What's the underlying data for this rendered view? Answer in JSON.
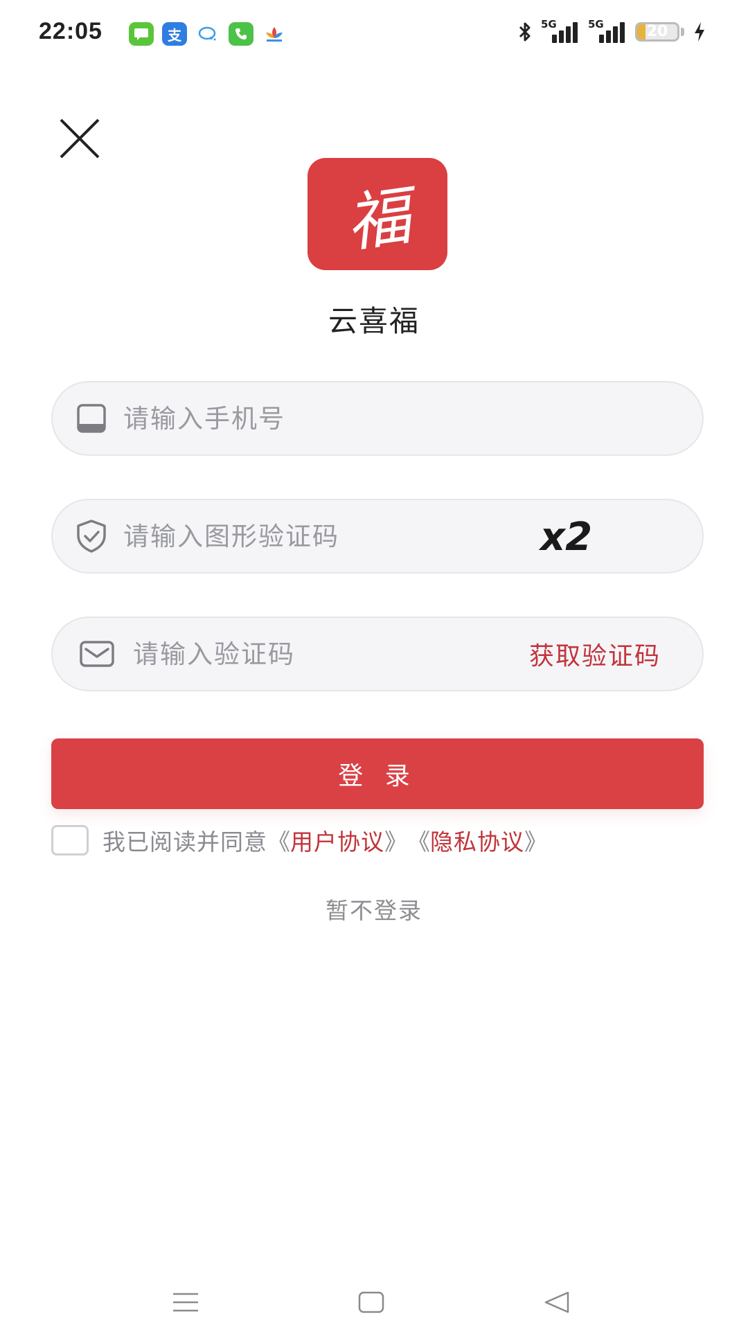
{
  "status_bar": {
    "time": "22:05",
    "notification_icons": [
      {
        "icon": "message-icon",
        "color": "#5ac53a",
        "glyph": "▬"
      },
      {
        "icon": "alipay-icon",
        "color": "#2f7de1",
        "glyph": "支"
      },
      {
        "icon": "bubble-icon",
        "color": "#ffffff",
        "glyph": "◌"
      },
      {
        "icon": "phone-icon",
        "color": "#4cc248",
        "glyph": "✆"
      },
      {
        "icon": "lotus-icon",
        "color": "#ffffff",
        "glyph": "✿"
      }
    ],
    "network_1": "5G",
    "network_2": "5G",
    "battery_level": "20",
    "battery_fraction": 0.2
  },
  "app": {
    "logo_glyph": "福",
    "name": "云喜福",
    "brand_color": "#da3f42"
  },
  "form": {
    "phone_placeholder": "请输入手机号",
    "captcha_placeholder": "请输入图形验证码",
    "captcha_text": "x2",
    "code_placeholder": "请输入验证码",
    "get_code_label": "获取验证码",
    "login_label": "登 录"
  },
  "agreement": {
    "prefix": "我已阅读并同意",
    "open_quote": "《",
    "close_quote": "》",
    "user_agreement": "用户协议",
    "privacy_agreement": "隐私协议"
  },
  "skip_label": "暂不登录"
}
